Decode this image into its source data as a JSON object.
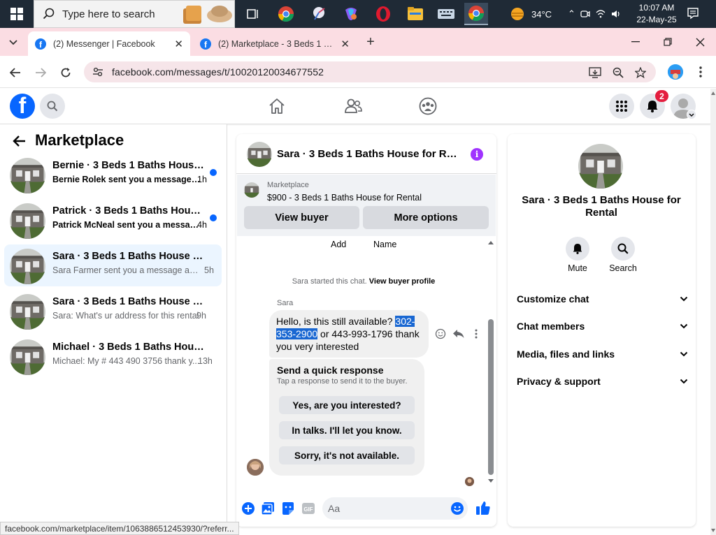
{
  "taskbar": {
    "search_placeholder": "Type here to search",
    "weather": "34°C",
    "clock_time": "10:07 AM",
    "clock_date": "22-May-25"
  },
  "browser": {
    "tabs": [
      {
        "title": "(2) Messenger | Facebook",
        "active": true
      },
      {
        "title": "(2) Marketplace - 3 Beds 1 Bath",
        "active": false
      }
    ],
    "url": "facebook.com/messages/t/10020120034677552",
    "status_url": "facebook.com/marketplace/item/1063886512453930/?referr..."
  },
  "fb_header": {
    "notification_count": "2"
  },
  "left_panel": {
    "title": "Marketplace",
    "conversations": [
      {
        "name": "Bernie · 3 Beds 1 Baths House for...",
        "preview": "Bernie Rolek sent you a message a...",
        "time": "1h",
        "unread": true,
        "selected": false
      },
      {
        "name": "Patrick · 3 Beds 1 Baths House fo...",
        "preview": "Patrick McNeal sent you a messag...",
        "time": "4h",
        "unread": true,
        "selected": false
      },
      {
        "name": "Sara · 3 Beds 1 Baths House for Re...",
        "preview": "Sara Farmer sent you a message abou...",
        "time": "5h",
        "unread": false,
        "selected": true
      },
      {
        "name": "Sara · 3 Beds 1 Baths House for Re...",
        "preview": "Sara: What's ur address for this rental",
        "time": "9h",
        "unread": false,
        "selected": false
      },
      {
        "name": "Michael · 3 Beds 1 Baths House for...",
        "preview": "Michael: My # 443 490 3756 thank y...",
        "time": "13h",
        "unread": false,
        "selected": false
      }
    ]
  },
  "chat": {
    "title": "Sara · 3 Beds 1 Baths House for Ren...",
    "listing_label": "Marketplace",
    "listing_title": "$900 - 3 Beds 1 Baths House for Rental",
    "view_buyer": "View buyer",
    "more_options": "More options",
    "add_label": "Add",
    "name_label": "Name",
    "started_text": "Sara started this chat.",
    "view_buyer_profile": "View buyer profile",
    "sender": "Sara",
    "message_before": "Hello, is this still available? ",
    "message_highlight": "302-353-2900",
    "message_after": " or 443-993-1796 thank you very interested",
    "quick_title": "Send a quick response",
    "quick_subtitle": "Tap a response to send it to the buyer.",
    "quick_responses": [
      "Yes, are you interested?",
      "In talks. I'll let you know.",
      "Sorry, it's not available."
    ],
    "composer_placeholder": "Aa"
  },
  "info_panel": {
    "name": "Sara · 3 Beds 1 Baths House for Rental",
    "mute_label": "Mute",
    "search_label": "Search",
    "sections": [
      "Customize chat",
      "Chat members",
      "Media, files and links",
      "Privacy & support"
    ]
  },
  "colors": {
    "fb_blue": "#0866ff",
    "unread_dot": "#0866ff",
    "badge_red": "#e41e3f",
    "highlight": "#1967d2",
    "tab_strip": "#fbdde3"
  }
}
